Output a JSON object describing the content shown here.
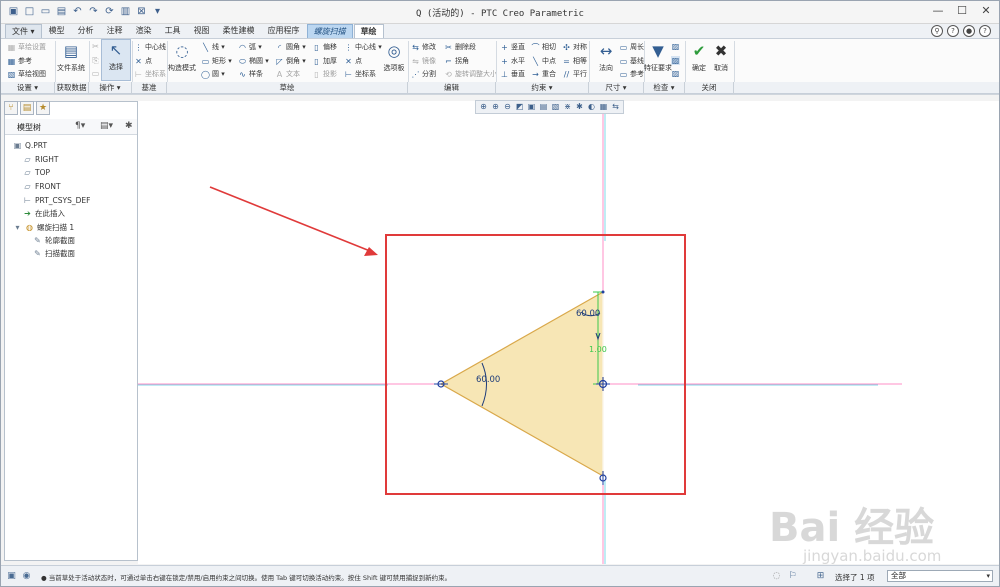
{
  "titlebar": {
    "title": "Q (活动的) - PTC Creo Parametric",
    "quick_access": [
      "new-icon",
      "open-icon",
      "save-icon",
      "undo-icon",
      "redo-icon",
      "regenerate-icon",
      "windows-icon",
      "close-window-icon",
      "customize-icon"
    ]
  },
  "tabs": [
    {
      "label": "文件 ▾",
      "kind": "file"
    },
    {
      "label": "模型",
      "kind": "normal"
    },
    {
      "label": "分析",
      "kind": "normal"
    },
    {
      "label": "注释",
      "kind": "normal"
    },
    {
      "label": "渲染",
      "kind": "normal"
    },
    {
      "label": "工具",
      "kind": "normal"
    },
    {
      "label": "视图",
      "kind": "normal"
    },
    {
      "label": "柔性建模",
      "kind": "normal"
    },
    {
      "label": "应用程序",
      "kind": "normal"
    },
    {
      "label": "螺旋扫描",
      "kind": "ctx"
    },
    {
      "label": "草绘",
      "kind": "active"
    }
  ],
  "ribbon": {
    "setup": {
      "items": [
        "草绘设置",
        "参考",
        "草绘视图"
      ],
      "label": "设置 ▾"
    },
    "get_data": {
      "big": "文件系统",
      "label": "获取数据"
    },
    "operations": {
      "big": "选择",
      "label": "操作 ▾"
    },
    "datum": {
      "items": [
        "中心线",
        "点",
        "坐标系"
      ],
      "label": "基准"
    },
    "sketch": {
      "construction": "构造模式",
      "col1": [
        "线 ▾",
        "矩形 ▾",
        "圆 ▾"
      ],
      "col2": [
        "弧 ▾",
        "椭圆 ▾",
        "样条"
      ],
      "col3": [
        "圆角 ▾",
        "倒角 ▾",
        "文本"
      ],
      "col4": [
        "偏移",
        "加厚",
        "投影"
      ],
      "col5": [
        "中心线 ▾",
        "点",
        "坐标系"
      ],
      "palette": "选项板",
      "label": "草绘"
    },
    "edit": {
      "items": [
        "修改",
        "删除段",
        "镜像",
        "拐角",
        "分割",
        "旋转调整大小"
      ],
      "label": "编辑"
    },
    "constrain": {
      "items": [
        "竖直",
        "相切",
        "对称",
        "水平",
        "中点",
        "相等",
        "垂直",
        "重合",
        "平行"
      ],
      "label": "约束 ▾"
    },
    "dimension": {
      "big": "法向",
      "items": [
        "周长",
        "基线",
        "参考"
      ],
      "label": "尺寸 ▾"
    },
    "inspect": {
      "big": "特征要求",
      "label": "检查 ▾"
    },
    "close": {
      "ok": "确定",
      "cancel": "取消",
      "label": "关闭"
    }
  },
  "model_tree": {
    "title": "模型树",
    "items": [
      {
        "label": "Q.PRT",
        "icon": "part-icon",
        "depth": 0
      },
      {
        "label": "RIGHT",
        "icon": "datum-plane-icon",
        "depth": 1
      },
      {
        "label": "TOP",
        "icon": "datum-plane-icon",
        "depth": 1
      },
      {
        "label": "FRONT",
        "icon": "datum-plane-icon",
        "depth": 1
      },
      {
        "label": "PRT_CSYS_DEF",
        "icon": "csys-icon",
        "depth": 1
      },
      {
        "label": "在此插入",
        "icon": "insert-arrow-icon",
        "depth": 1
      },
      {
        "label": "螺旋扫描 1",
        "icon": "helical-sweep-icon",
        "depth": 1
      },
      {
        "label": "轮廓截面",
        "icon": "sketch-icon",
        "depth": 2
      },
      {
        "label": "扫描截面",
        "icon": "sketch-icon",
        "depth": 2
      }
    ]
  },
  "sketch": {
    "dims": {
      "top_angle": "60.00",
      "left_angle": "60.00",
      "side": "1.00"
    },
    "fill_color": "#f7e6b5",
    "edge_color": "#d9a84a",
    "highlight_color": "#e03a3a"
  },
  "status": {
    "message": "● 当前草处于活动状态时，可通过单击右键在锁定/禁用/启用约束之间切换。使用 Tab 键可切换活动约束。按住 Shift 键可禁用捕捉到新约束。",
    "selected": "选择了 1 项",
    "filter": "全部"
  },
  "watermark": {
    "text": "Bai 经验",
    "sub": "jingyan.baidu.com"
  }
}
